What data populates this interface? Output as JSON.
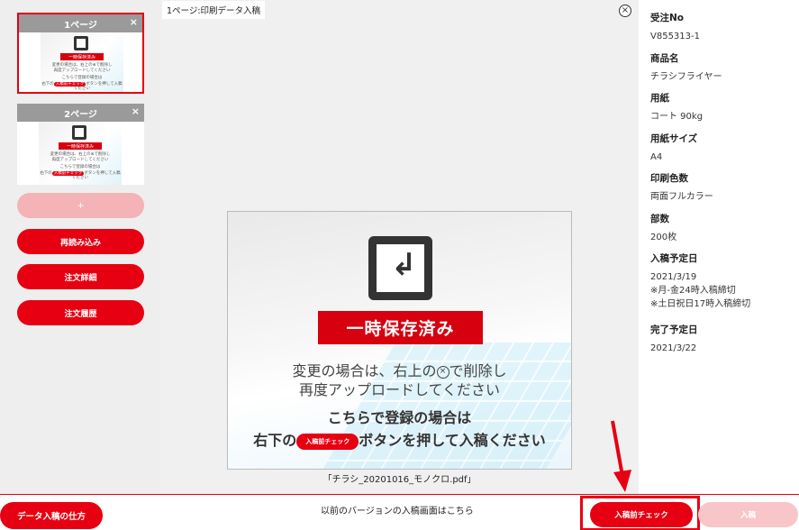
{
  "sidebar": {
    "pages": [
      {
        "title": "1ページ",
        "close": "×",
        "mini_banner": "一時保存済み",
        "mini_lines": [
          "変更の場合は、右上の⊗で削除し",
          "再度アップロードしてください",
          "こちらで登録の場合は",
          "右下の",
          "ボタンを押して入稿ください"
        ],
        "mini_btn": "入稿前チェック",
        "active": true
      },
      {
        "title": "2ページ",
        "close": "×",
        "mini_banner": "一時保存済み",
        "mini_lines": [
          "変更の場合は、右上の⊗で削除し",
          "再度アップロードしてください",
          "こちらで登録の場合は",
          "右下の",
          "ボタンを押して入稿ください"
        ],
        "mini_btn": "入稿前チェック",
        "active": false
      }
    ],
    "add_label": "+",
    "buttons": [
      "再読み込み",
      "注文詳細",
      "注文履歴"
    ]
  },
  "center": {
    "page_label": "1ページ:印刷データ入稿",
    "close_icon": "×",
    "preview": {
      "banner": "一時保存済み",
      "line1_a": "変更の場合は、右上の",
      "line1_x": "×",
      "line1_b": "で削除し",
      "line2": "再度アップロードしてください",
      "line3": "こちらで登録の場合は",
      "line4_a": "右下の",
      "line4_btn": "入稿前チェック",
      "line4_b": "ボタンを押して入稿ください"
    },
    "filename": "「チラシ_20201016_モノクロ.pdf」"
  },
  "info": [
    {
      "label": "受注No",
      "value": "V855313-1"
    },
    {
      "label": "商品名",
      "value": "チラシフライヤー"
    },
    {
      "label": "用紙",
      "value": "コート 90kg"
    },
    {
      "label": "用紙サイズ",
      "value": "A4"
    },
    {
      "label": "印刷色数",
      "value": "両面フルカラー"
    },
    {
      "label": "部数",
      "value": "200枚"
    },
    {
      "label": "入稿予定日",
      "value": "2021/3/19",
      "notes": [
        "※月-金24時入稿締切",
        "※土日祝日17時入稿締切"
      ]
    },
    {
      "label": "完了予定日",
      "value": "2021/3/22"
    }
  ],
  "footer": {
    "help_button": "データ入稿の仕方",
    "old_version_link": "以前のバージョンの入稿画面はこちら",
    "check_button": "入稿前チェック",
    "submit_button": "入稿"
  },
  "colors": {
    "accent": "#e60012",
    "accent_light": "#f8c6c8"
  }
}
